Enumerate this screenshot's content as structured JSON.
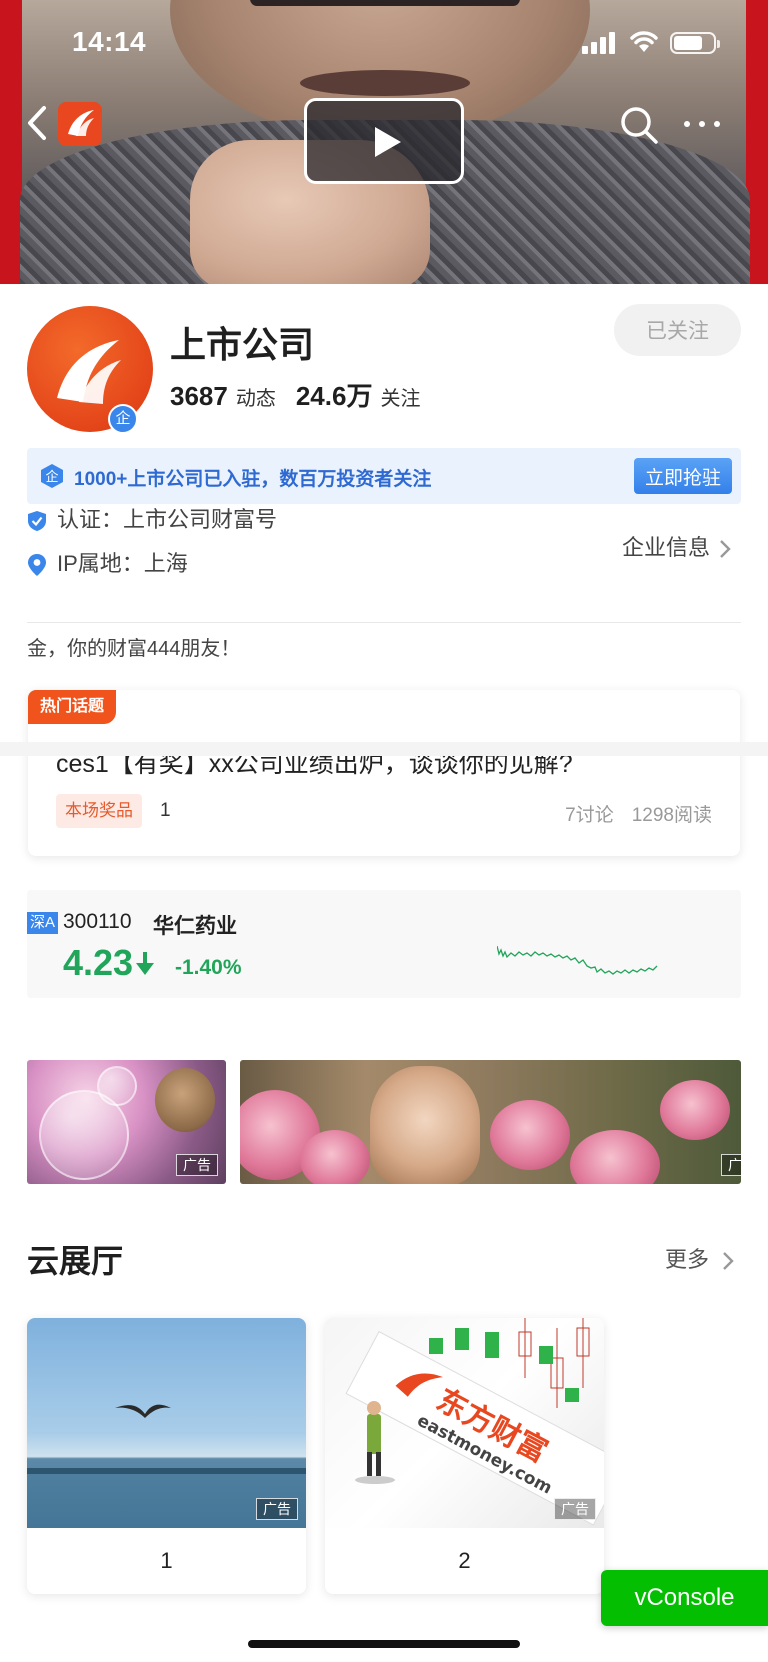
{
  "status_bar": {
    "time": "14:14"
  },
  "header": {
    "nav_icons": [
      "back-icon",
      "eastmoney-logo-icon",
      "play-icon",
      "search-icon",
      "more-icon"
    ]
  },
  "profile": {
    "name": "上市公司",
    "posts_count": "3687",
    "posts_label": "动态",
    "followers_count": "24.6万",
    "followers_label": "关注",
    "follow_button": "已关注",
    "avatar_badge": "企"
  },
  "banner": {
    "badge": "企",
    "text": "1000+上市公司已入驻，数百万投资者关注",
    "button": "立即抢驻"
  },
  "info": {
    "verified": "认证：上市公司财富号",
    "ip_location": "IP属地：上海",
    "corp_info_link": "企业信息",
    "greeting": "金，你的财富444朋友！"
  },
  "topic": {
    "tag": "热门话题",
    "title": "ces1【有奖】xx公司业绩出炉，谈谈你的见解?",
    "prize_label": "本场奖品",
    "prize_value": "1",
    "discussions": "7讨论",
    "reads": "1298阅读"
  },
  "stock": {
    "market": "深A",
    "code": "300110",
    "name": "华仁药业",
    "price": "4.23",
    "change": "-1.40%",
    "color": "#21a55a"
  },
  "ads": [
    {
      "label": "广告"
    },
    {
      "label": "广"
    }
  ],
  "cloud_hall": {
    "title": "云展厅",
    "more": "更多",
    "cards": [
      {
        "caption": "1",
        "ad_label": "广告"
      },
      {
        "caption": "2",
        "ad_label": "广告",
        "logo_cn": "东方财富",
        "logo_en": "eastmoney.com"
      }
    ]
  },
  "vconsole": "vConsole",
  "colors": {
    "brand": "#e8471f",
    "accent_blue": "#3a86ea",
    "down_green": "#21a55a",
    "vconsole": "#04be02"
  }
}
